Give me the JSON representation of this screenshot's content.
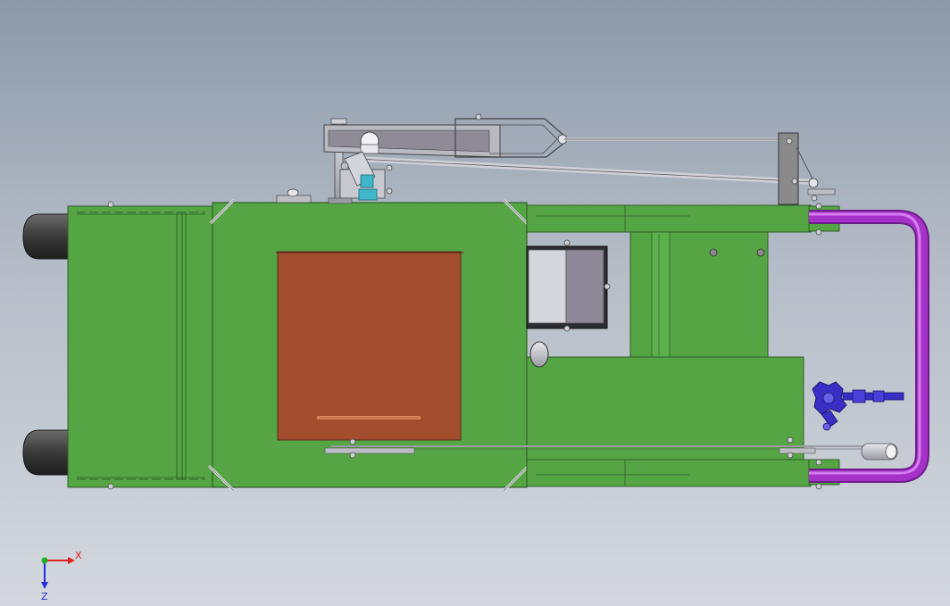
{
  "triad": {
    "x_label": "X",
    "z_label": "Z",
    "x_color": "#e02020",
    "y_color": "#20b020",
    "z_color": "#2030e0"
  },
  "colors": {
    "frame_green": "#55a544",
    "frame_stroke": "#2f5f2a",
    "panel_copper": "#a14d2e",
    "pipe_purple": "#a432c8",
    "valve_blue": "#3a2fc4",
    "wheel_dark": "#3c3c3c",
    "metal_grey": "#b9b9c2",
    "fitting_cyan": "#3fb6c9"
  }
}
